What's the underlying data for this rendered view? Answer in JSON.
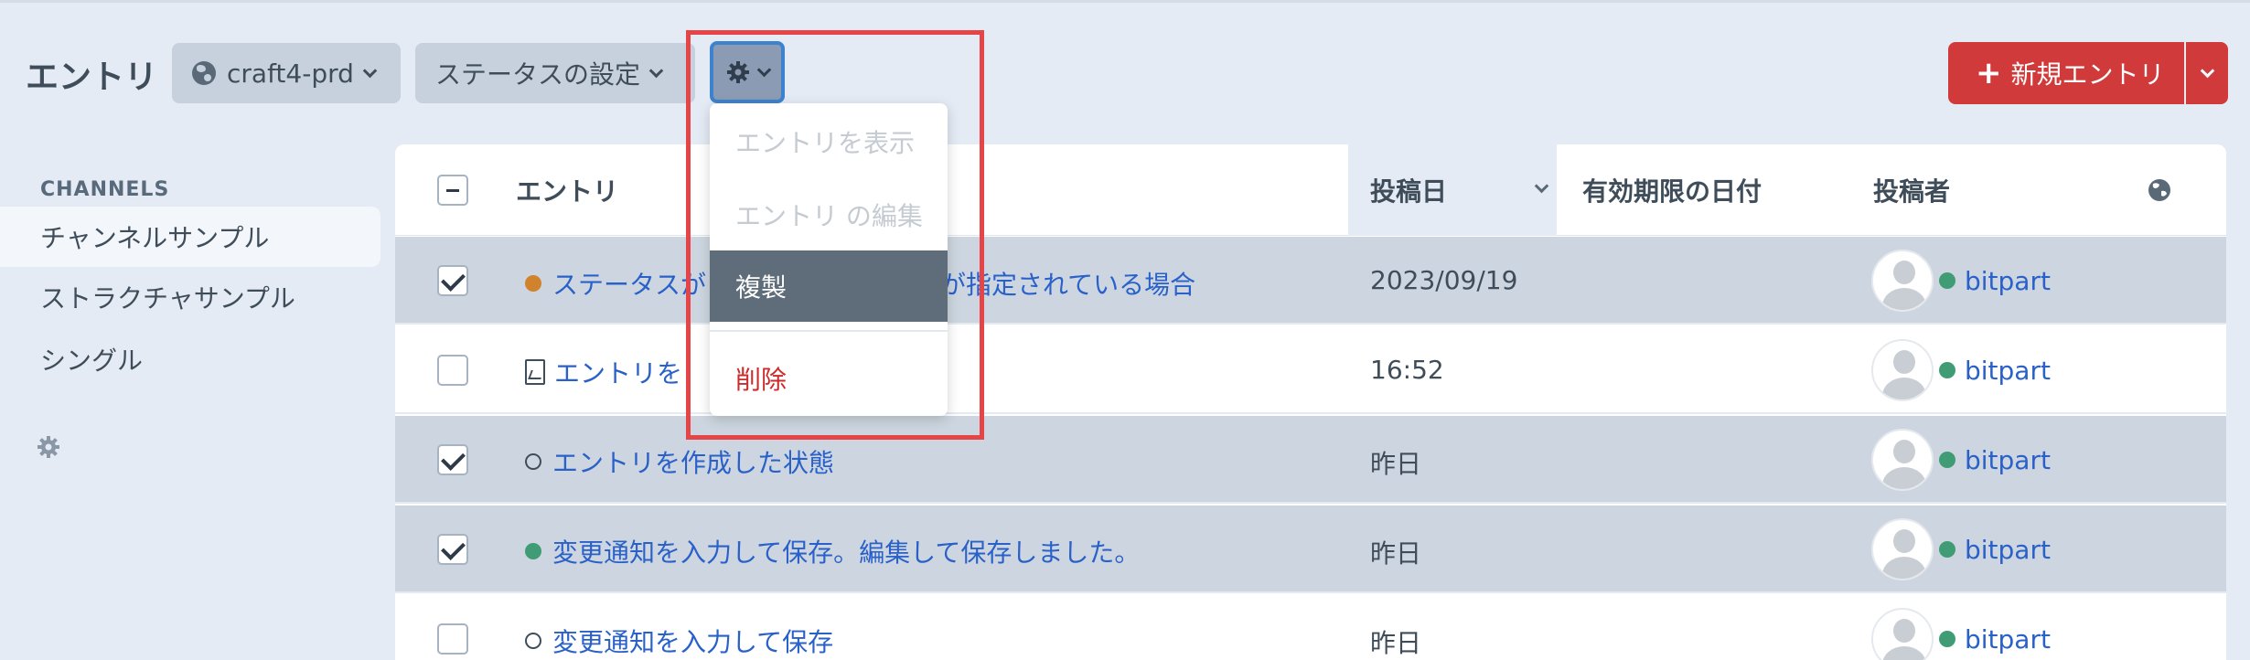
{
  "header": {
    "title": "エントリ",
    "site_label": "craft4-prd",
    "status_label": "ステータスの設定",
    "new_entry_label": "新規エントリ"
  },
  "sidebar": {
    "heading": "CHANNELS",
    "items": [
      {
        "label": "チャンネルサンプル",
        "active": true
      },
      {
        "label": "ストラクチャサンプル",
        "active": false
      },
      {
        "label": "シングル",
        "active": false
      }
    ]
  },
  "table": {
    "columns": {
      "title": "エントリ",
      "post_date": "投稿日",
      "expiry_date": "有効期限の日付",
      "author": "投稿者"
    },
    "rows": [
      {
        "checked": true,
        "status": "orange",
        "title_left": "ステータスが",
        "title_right": "が指定されている場合",
        "date": "2023/09/19",
        "author": "bitpart"
      },
      {
        "checked": false,
        "status": "draft",
        "title": "エントリを",
        "date": "16:52",
        "author": "bitpart"
      },
      {
        "checked": true,
        "status": "disabled",
        "title": "エントリを作成した状態",
        "date": "昨日",
        "author": "bitpart"
      },
      {
        "checked": true,
        "status": "live",
        "title": "変更通知を入力して保存。編集して保存しました。",
        "date": "昨日",
        "author": "bitpart"
      },
      {
        "checked": false,
        "status": "disabled",
        "title": "変更通知を入力して保存",
        "date": "昨日",
        "author": "bitpart"
      }
    ]
  },
  "actions_menu": {
    "items": [
      {
        "label": "エントリを表示",
        "state": "disabled"
      },
      {
        "label": "エントリ の編集",
        "state": "disabled"
      },
      {
        "label": "複製",
        "state": "active"
      },
      {
        "label": "削除",
        "state": "danger"
      }
    ]
  },
  "colors": {
    "accent_red": "#d13a3b",
    "link_blue": "#2a61c9",
    "status_orange": "#d0822c",
    "status_green": "#3f9c75",
    "highlight_box": "#e64547"
  },
  "icons": [
    "globe-icon",
    "chevron-down-icon",
    "gear-icon",
    "plus-icon",
    "draft-document-icon"
  ]
}
